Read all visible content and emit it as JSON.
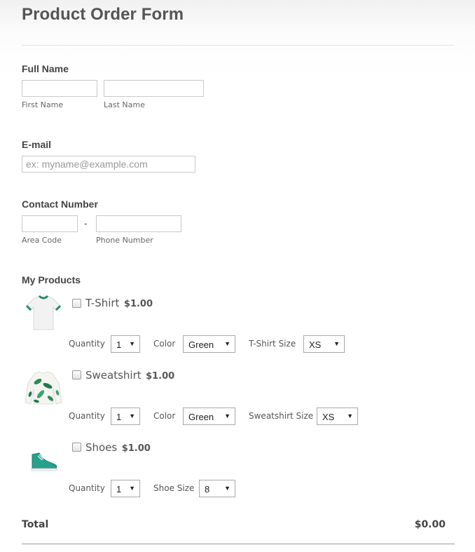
{
  "form": {
    "title": "Product Order Form"
  },
  "full_name": {
    "label": "Full Name",
    "first_sublabel": "First Name",
    "last_sublabel": "Last Name",
    "first_value": "",
    "last_value": ""
  },
  "email": {
    "label": "E-mail",
    "placeholder": "ex: myname@example.com",
    "value": ""
  },
  "contact": {
    "label": "Contact Number",
    "separator": "-",
    "area_sublabel": "Area Code",
    "phone_sublabel": "Phone Number",
    "area_value": "",
    "phone_value": ""
  },
  "products": {
    "label": "My Products",
    "quantity_label": "Quantity",
    "color_label": "Color",
    "items": [
      {
        "name": "T-Shirt",
        "price": "$1.00",
        "checked": false,
        "icon": "tshirt-image",
        "quantity": "1",
        "color": "Green",
        "size_label": "T-Shirt Size",
        "size": "XS"
      },
      {
        "name": "Sweatshirt",
        "price": "$1.00",
        "checked": false,
        "icon": "sweatshirt-image",
        "quantity": "1",
        "color": "Green",
        "size_label": "Sweatshirt Size",
        "size": "XS"
      },
      {
        "name": "Shoes",
        "price": "$1.00",
        "checked": false,
        "icon": "shoe-image",
        "quantity": "1",
        "size_label": "Shoe Size",
        "size": "8"
      }
    ]
  },
  "total": {
    "label": "Total",
    "value": "$0.00"
  },
  "colors": {
    "text": "#555555",
    "border": "#c9c9c9",
    "accent_green": "#2a9d8f"
  }
}
